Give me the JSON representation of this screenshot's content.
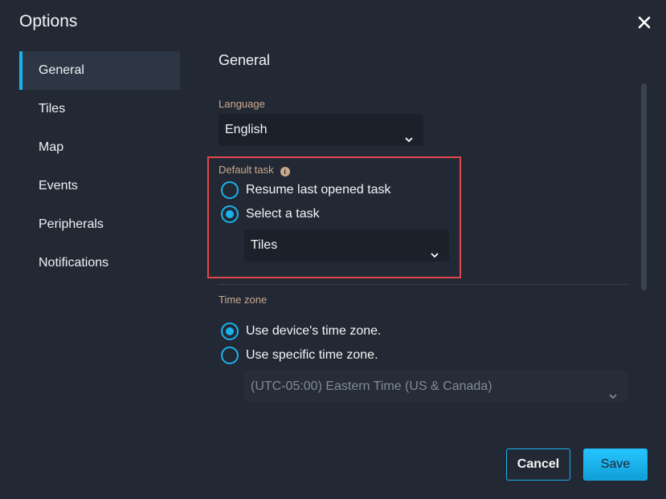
{
  "dialog": {
    "title": "Options",
    "close_icon": "close-icon"
  },
  "nav": {
    "items": [
      {
        "label": "General",
        "active": true
      },
      {
        "label": "Tiles",
        "active": false
      },
      {
        "label": "Map",
        "active": false
      },
      {
        "label": "Events",
        "active": false
      },
      {
        "label": "Peripherals",
        "active": false
      },
      {
        "label": "Notifications",
        "active": false
      }
    ]
  },
  "general": {
    "title": "General",
    "language": {
      "label": "Language",
      "value": "English"
    },
    "default_task": {
      "label": "Default task",
      "info_icon": "info-icon",
      "options": [
        {
          "label": "Resume last opened task",
          "checked": false
        },
        {
          "label": "Select a task",
          "checked": true
        }
      ],
      "task_value": "Tiles"
    },
    "time_zone": {
      "label": "Time zone",
      "options": [
        {
          "label": "Use device's time zone.",
          "checked": true
        },
        {
          "label": "Use specific time zone.",
          "checked": false
        }
      ],
      "zone_value": "(UTC-05:00) Eastern Time (US & Canada)"
    }
  },
  "footer": {
    "cancel_label": "Cancel",
    "save_label": "Save"
  },
  "colors": {
    "background": "#232934",
    "accent": "#19b2ec",
    "highlight_border": "#e0474c",
    "label": "#c9a98e"
  }
}
